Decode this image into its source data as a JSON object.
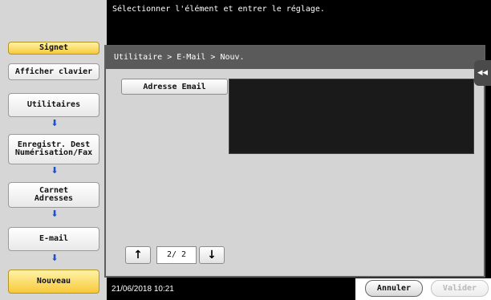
{
  "top_message": "Sélectionner l'élément et entrer le réglage.",
  "left_panel": {
    "signet": "Signet",
    "afficher_clavier": "Afficher clavier",
    "steps": [
      "Utilitaires",
      "Enregistr. Dest Numérisation/Fax",
      "Carnet Adresses",
      "E-mail",
      "Nouveau"
    ]
  },
  "breadcrumb": "Utilitaire > E-Mail > Nouv.",
  "back_tab": "◂◂",
  "form": {
    "email_label": "Adresse Email",
    "email_value": ""
  },
  "pagination": {
    "up": "↑",
    "down": "↓",
    "indicator": "2/ 2"
  },
  "bottom": {
    "datetime": "21/06/2018   10:21",
    "cancel": "Annuler",
    "validate": "Valider"
  }
}
